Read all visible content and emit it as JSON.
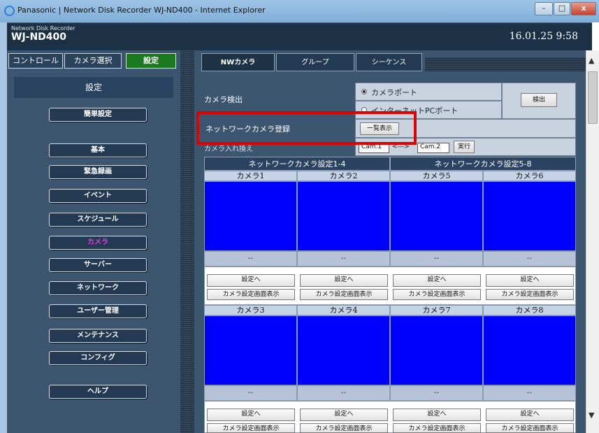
{
  "window": {
    "title": "Panasonic | Network Disk Recorder WJ-ND400 - Internet Explorer",
    "minimize": "–",
    "maximize": "□",
    "close": "x"
  },
  "header": {
    "subtitle": "Network Disk Recorder",
    "model": "WJ-ND400",
    "datetime": "16.01.25  9:58"
  },
  "top_nav": {
    "control": "コントロール",
    "camera_select": "カメラ選択",
    "settings": "設定"
  },
  "sidebar": {
    "title": "設定",
    "items": [
      {
        "label": "簡単設定"
      },
      {
        "label": "基本"
      },
      {
        "label": "緊急録画"
      },
      {
        "label": "イベント"
      },
      {
        "label": "スケジュール"
      },
      {
        "label": "カメラ"
      },
      {
        "label": "サーバー"
      },
      {
        "label": "ネットワーク"
      },
      {
        "label": "ユーザー管理"
      },
      {
        "label": "メンテナンス"
      },
      {
        "label": "コンフィグ"
      },
      {
        "label": "ヘルプ"
      }
    ],
    "selected": "カメラ"
  },
  "tabs": [
    {
      "label": "NWカメラ"
    },
    {
      "label": "グループ"
    },
    {
      "label": "シーケンス"
    }
  ],
  "settings": {
    "camera_detect_label": "カメラ検出",
    "camera_port_option": "カメラポート",
    "pc_port_option": "インターネットPCポート",
    "detect_button": "検出",
    "network_register_label": "ネットワークカメラ登録",
    "list_button": "一覧表示",
    "camera_swap_label": "カメラ入れ換え",
    "cam_from": "Cam.1",
    "cam_arrow": "<--->",
    "cam_to": "Cam.2",
    "execute_button": "実行"
  },
  "grid": {
    "header_left": "ネットワークカメラ設定1-4",
    "header_right": "ネットワークカメラ設定5-8",
    "cameras_row1": [
      "カメラ1",
      "カメラ2",
      "カメラ5",
      "カメラ6"
    ],
    "cameras_row2": [
      "カメラ3",
      "カメラ4",
      "カメラ7",
      "カメラ8"
    ],
    "status": "--",
    "settings_button": "設定へ",
    "display_button": "カメラ設定画面表示"
  },
  "colors": {
    "active_green": "#1b7a1f",
    "selected_magenta": "#e23be2",
    "highlight_red": "#e00000",
    "camera_blue": "#0000ff"
  }
}
